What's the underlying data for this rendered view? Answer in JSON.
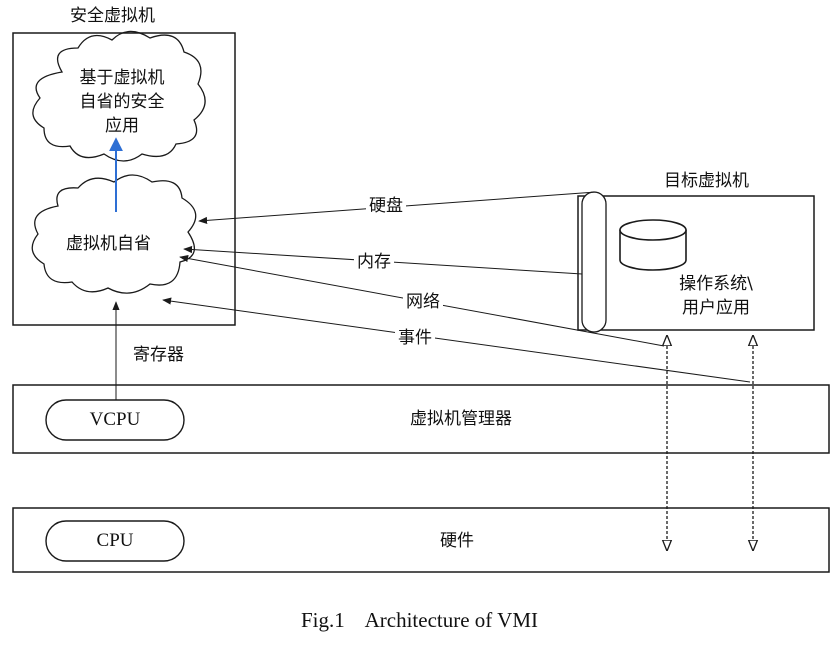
{
  "security_vm": {
    "title": "安全虚拟机",
    "app_cloud_lines": [
      "基于虚拟机",
      "自省的安全",
      "应用"
    ],
    "introspection_label": "虚拟机自省"
  },
  "target_vm": {
    "title": "目标虚拟机",
    "os_label_lines": [
      "操作系统\\",
      "用户应用"
    ]
  },
  "links": {
    "disk": "硬盘",
    "memory": "内存",
    "network": "网络",
    "event": "事件",
    "register": "寄存器"
  },
  "hypervisor": {
    "label": "虚拟机管理器",
    "vcpu": "VCPU"
  },
  "hardware": {
    "label": "硬件",
    "cpu": "CPU"
  },
  "caption": "Fig.1    Architecture of VMI",
  "colors": {
    "line": "#1a1a1a",
    "accent_arrow": "#2e6fd4"
  }
}
